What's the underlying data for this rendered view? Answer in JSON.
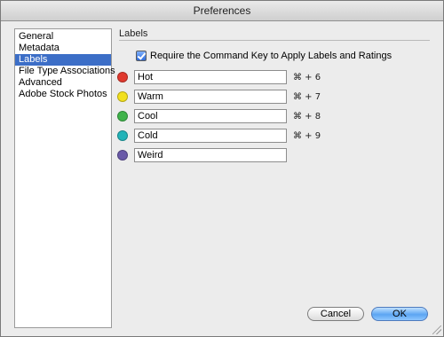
{
  "window": {
    "title": "Preferences"
  },
  "sidebar": {
    "items": [
      {
        "label": "General"
      },
      {
        "label": "Metadata"
      },
      {
        "label": "Labels",
        "selected": true
      },
      {
        "label": "File Type Associations"
      },
      {
        "label": "Advanced"
      },
      {
        "label": "Adobe Stock Photos"
      }
    ]
  },
  "main": {
    "section_title": "Labels",
    "require_command": {
      "label": "Require the Command Key to Apply Labels and Ratings",
      "checked": true
    },
    "labels": [
      {
        "name": "Hot",
        "color": "#e0392e",
        "shortcut": "⌘ + 6"
      },
      {
        "name": "Warm",
        "color": "#f2e01e",
        "shortcut": "⌘ + 7"
      },
      {
        "name": "Cool",
        "color": "#3fb34a",
        "shortcut": "⌘ + 8"
      },
      {
        "name": "Cold",
        "color": "#22b3b8",
        "shortcut": "⌘ + 9"
      },
      {
        "name": "Weird",
        "color": "#6a5aa8",
        "shortcut": ""
      }
    ]
  },
  "buttons": {
    "cancel": "Cancel",
    "ok": "OK"
  }
}
